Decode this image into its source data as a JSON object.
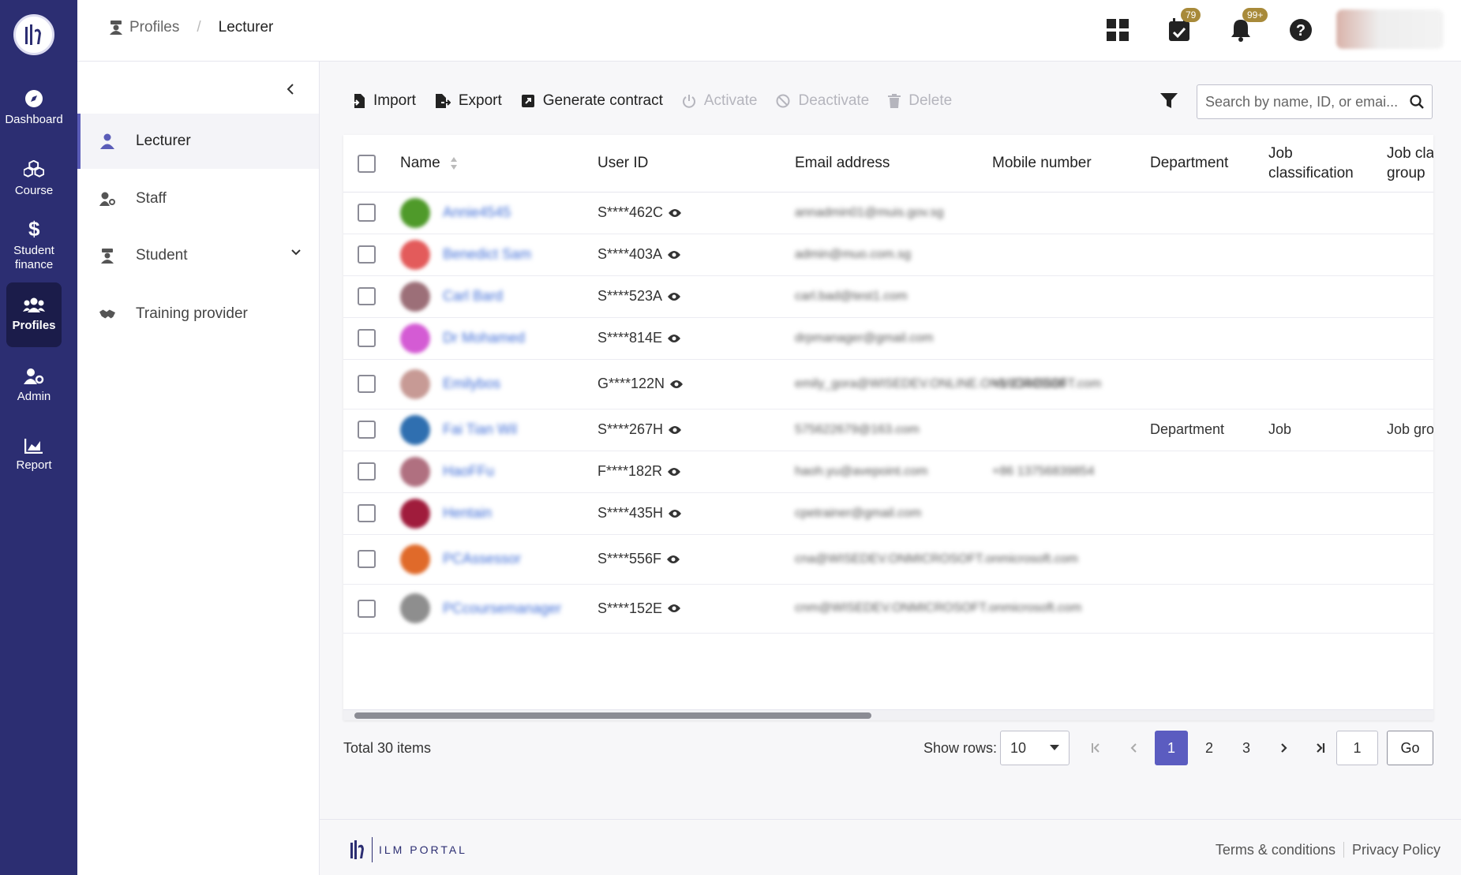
{
  "rail": {
    "items": [
      {
        "label": "Dashboard",
        "icon": "compass-icon"
      },
      {
        "label": "Course",
        "icon": "cubes-icon"
      },
      {
        "label": "Student finance",
        "icon": "dollar-icon"
      },
      {
        "label": "Profiles",
        "icon": "users-icon"
      },
      {
        "label": "Admin",
        "icon": "user-cog-icon"
      },
      {
        "label": "Report",
        "icon": "chart-icon"
      }
    ],
    "active": "Profiles"
  },
  "header": {
    "breadcrumb_parent": "Profiles",
    "breadcrumb_separator": "/",
    "breadcrumb_current": "Lecturer",
    "tasks_badge": "79",
    "notifications_badge": "99+"
  },
  "subnav": {
    "items": [
      {
        "label": "Lecturer"
      },
      {
        "label": "Staff"
      },
      {
        "label": "Student"
      },
      {
        "label": "Training provider"
      }
    ]
  },
  "toolbar": {
    "import": "Import",
    "export": "Export",
    "generate_contract": "Generate contract",
    "activate": "Activate",
    "deactivate": "Deactivate",
    "delete": "Delete",
    "search_placeholder": "Search by name, ID, or emai..."
  },
  "table": {
    "columns": {
      "name": "Name",
      "user_id": "User ID",
      "email": "Email address",
      "mobile": "Mobile number",
      "department": "Department",
      "job_classification": "Job classification",
      "job_class_group": "Job class group"
    },
    "rows": [
      {
        "name": "Annie4545",
        "user_id": "S****462C",
        "email": "annadmin01@muis.gov.sg",
        "mobile": "",
        "department": "",
        "job": "",
        "group": "",
        "avatar_color": "#4f9a2a"
      },
      {
        "name": "Benedict Sam",
        "user_id": "S****403A",
        "email": "admin@muo.com.sg",
        "mobile": "",
        "department": "",
        "job": "",
        "group": "",
        "avatar_color": "#e35b5b"
      },
      {
        "name": "Carl Bard",
        "user_id": "S****523A",
        "email": "carl.bad@test1.com",
        "mobile": "",
        "department": "",
        "job": "",
        "group": "",
        "avatar_color": "#9c6f78"
      },
      {
        "name": "Dr Mohamed",
        "user_id": "S****814E",
        "email": "drpmanager@gmail.com",
        "mobile": "",
        "department": "",
        "job": "",
        "group": "",
        "avatar_color": "#d45bd4"
      },
      {
        "name": "Emilybos",
        "user_id": "G****122N",
        "email": "emily_gora@WISEDEV.ONLINE.ONMICROSOFT.com",
        "mobile": "+1 23445566",
        "department": "",
        "job": "",
        "group": "",
        "avatar_color": "#c79a95"
      },
      {
        "name": "Fai Tian Wil",
        "user_id": "S****267H",
        "email": "575622679@163.com",
        "mobile": "",
        "department": "Department",
        "job": "Job",
        "group": "Job gro",
        "avatar_color": "#2f6fb0"
      },
      {
        "name": "HaoFFu",
        "user_id": "F****182R",
        "email": "haoh.yu@avepoint.com",
        "mobile": "+86 13756839854",
        "department": "",
        "job": "",
        "group": "",
        "avatar_color": "#b07080"
      },
      {
        "name": "Hentain",
        "user_id": "S****435H",
        "email": "cpetrainer@gmail.com",
        "mobile": "",
        "department": "",
        "job": "",
        "group": "",
        "avatar_color": "#a01c3c"
      },
      {
        "name": "PCAssessor",
        "user_id": "S****556F",
        "email": "cna@WISEDEV.ONMICROSOFT.onmicrosoft.com",
        "mobile": "",
        "department": "",
        "job": "",
        "group": "",
        "avatar_color": "#e06a2a"
      },
      {
        "name": "PCcoursemanager",
        "user_id": "S****152E",
        "email": "cnm@WISEDEV.ONMICROSOFT.onmicrosoft.com",
        "mobile": "",
        "department": "",
        "job": "",
        "group": "",
        "avatar_color": "#8e8e8e"
      }
    ]
  },
  "pagination": {
    "total": "Total 30 items",
    "show_rows_label": "Show rows:",
    "rows_value": "10",
    "pages": [
      "1",
      "2",
      "3"
    ],
    "current_page": "1",
    "goto_value": "1",
    "go_label": "Go"
  },
  "footer": {
    "logo_text": "ILM PORTAL",
    "terms": "Terms & conditions",
    "privacy": "Privacy Policy"
  },
  "colors": {
    "rail_bg": "#2c2e72",
    "accent": "#5b5cc0",
    "badge": "#a88a3a"
  }
}
